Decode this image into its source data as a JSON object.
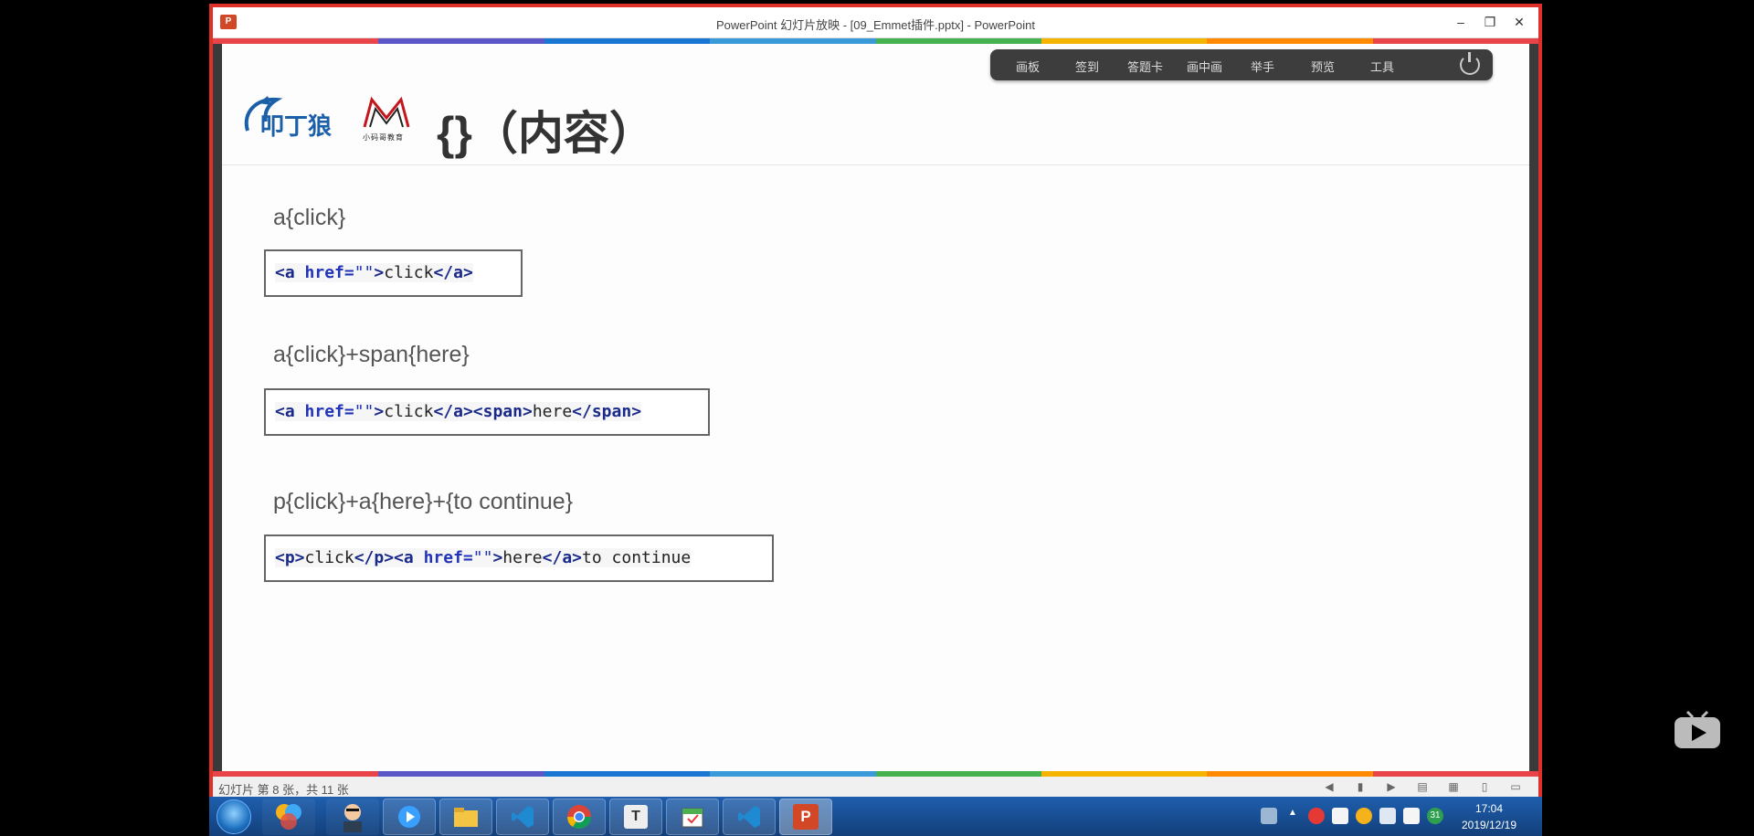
{
  "window": {
    "title": "PowerPoint 幻灯片放映 - [09_Emmet插件.pptx] - PowerPoint",
    "app_icon": "P",
    "controls": [
      "–",
      "❐",
      "✕"
    ]
  },
  "stripe_colors": [
    "#e8454b",
    "#5b57c9",
    "#1976d2",
    "#3a9ad9",
    "#45b14f",
    "#f4b400",
    "#ff8a00",
    "#e8454b"
  ],
  "toolbar": {
    "items": [
      "画板",
      "签到",
      "答题卡",
      "画中画",
      "举手",
      "预览",
      "工具"
    ]
  },
  "logos": {
    "ding": "叩丁狼",
    "m_caption": "小码哥教育"
  },
  "slide": {
    "title": "{}（内容）",
    "examples": [
      {
        "label": "a{click}"
      },
      {
        "label": "a{click}+span{here}"
      },
      {
        "label": "p{click}+a{here}+{to continue}"
      }
    ],
    "code": {
      "c1": {
        "t1": "<a",
        "a1": " href=",
        "s1": "\"\"",
        "t2": ">",
        "x1": "click",
        "t3": "</a>"
      },
      "c2": {
        "t1": "<a",
        "a1": " href=",
        "s1": "\"\"",
        "t2": ">",
        "x1": "click",
        "t3": "</a><span>",
        "x2": "here",
        "t4": "</span>"
      },
      "c3": {
        "t1": "<p>",
        "x1": "click",
        "t2": "</p><a",
        "a1": " href=",
        "s1": "\"\"",
        "t3": ">",
        "x2": "here",
        "t4": "</a>",
        "x3": "to continue"
      }
    }
  },
  "statusbar": {
    "slide_num": "幻灯片 第 8 张，共 11 张"
  },
  "taskbar": {
    "clock_time": "17:04",
    "clock_date": "2019/12/19",
    "apps": [
      "start",
      "360",
      "avatar",
      "bili",
      "folder",
      "vscode",
      "chrome",
      "typora",
      "calendar",
      "vscode",
      "powerpoint"
    ],
    "ppt_label": "P",
    "typora_label": "T",
    "badge": "31"
  },
  "colors": {
    "accent_red": "#e0302a",
    "code_tag": "#1a2a8a"
  }
}
